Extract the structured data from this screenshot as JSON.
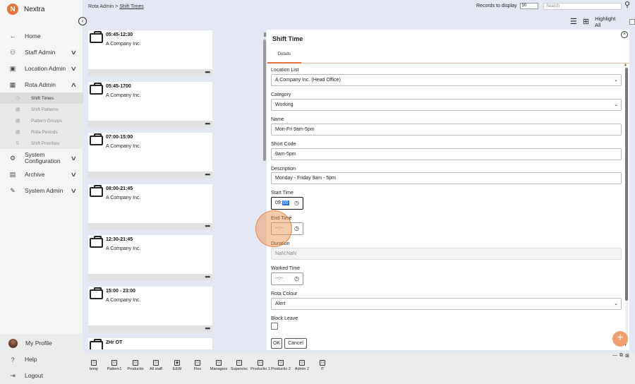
{
  "brand": {
    "name": "Nextra",
    "logo_letter": "N"
  },
  "sidebar": {
    "items": [
      {
        "icon": "arrow-left-icon",
        "glyph": "←",
        "label": "Home",
        "has_chevron": false
      },
      {
        "icon": "staff-icon",
        "glyph": "⚇",
        "label": "Staff Admin",
        "has_chevron": true
      },
      {
        "icon": "location-icon",
        "glyph": "▣",
        "label": "Location Admin",
        "has_chevron": true
      },
      {
        "icon": "calendar-icon",
        "glyph": "▦",
        "label": "Rota Admin",
        "has_chevron": true,
        "expanded": true
      },
      {
        "icon": "settings-icon",
        "glyph": "⚙",
        "label": "System Configuration",
        "has_chevron": true
      },
      {
        "icon": "archive-icon",
        "glyph": "▤",
        "label": "Archive",
        "has_chevron": true
      },
      {
        "icon": "wrench-icon",
        "glyph": "✎",
        "label": "System Admin",
        "has_chevron": true
      }
    ],
    "sub_items": [
      {
        "label": "Shift Times",
        "active": true
      },
      {
        "label": "Shift Patterns",
        "active": false
      },
      {
        "label": "Pattern Groups",
        "active": false
      },
      {
        "label": "Rota Periods",
        "active": false
      },
      {
        "label": "Shift Priorities",
        "active": false
      }
    ],
    "footer": [
      {
        "icon": "avatar",
        "label": "My Profile"
      },
      {
        "icon": "help-icon",
        "glyph": "?",
        "label": "Help"
      },
      {
        "icon": "logout-icon",
        "glyph": "⇥",
        "label": "Logout"
      }
    ]
  },
  "breadcrumb": {
    "parent": "Rota Admin",
    "separator": ">",
    "current": "Shift Times"
  },
  "toolbar": {
    "records_label": "Records to display",
    "records_value": "50",
    "search_placeholder": "Search",
    "highlight_label": "Highlight All"
  },
  "cards": [
    {
      "title": "05:45-12:30",
      "company": "A Company Inc."
    },
    {
      "title": "05:45-1700",
      "company": "A Company Inc."
    },
    {
      "title": "07:00-15:00",
      "company": "A Company Inc."
    },
    {
      "title": "08:00-21:45",
      "company": "A Company Inc."
    },
    {
      "title": "12:30-21:45",
      "company": "A Company Inc."
    },
    {
      "title": "15:00 - 23:00",
      "company": "A Company Inc."
    },
    {
      "title": "2Hr OT",
      "company": ""
    }
  ],
  "panel": {
    "title": "Shift Time",
    "tab": "Details",
    "fields": {
      "location_list": {
        "label": "Location List",
        "value": "A Company Inc. (Head Office)"
      },
      "category": {
        "label": "Category",
        "value": "Working"
      },
      "name": {
        "label": "Name",
        "value": "Mon-Fri 9am-5pm"
      },
      "short_code": {
        "label": "Short Code",
        "value": "9am-5pm"
      },
      "description": {
        "label": "Description",
        "value": "Monday - Friday 9am - 5pm"
      },
      "start_time": {
        "label": "Start Time",
        "hour": "09:",
        "minute": "00"
      },
      "end_time": {
        "label": "End Time",
        "value": "--:--"
      },
      "duration": {
        "label": "Duration",
        "value": "NaN:NaN"
      },
      "worked_time": {
        "label": "Worked Time",
        "value": "--:--"
      },
      "rota_colour": {
        "label": "Rota Colour",
        "value": "Alert"
      },
      "block_leave": {
        "label": "Block Leave",
        "checked": false
      }
    },
    "buttons": {
      "ok": "OK",
      "cancel": "Cancel"
    }
  },
  "taskbar": [
    {
      "label": "temp"
    },
    {
      "label": "Pattern1"
    },
    {
      "label": "Productio"
    },
    {
      "label": "All staff"
    },
    {
      "label": "E&W"
    },
    {
      "label": "Flex"
    },
    {
      "label": "Managers"
    },
    {
      "label": "Supervisc"
    },
    {
      "label": "Productio 1"
    },
    {
      "label": "Productio 2"
    },
    {
      "label": "Admin 2"
    },
    {
      "label": "IT"
    }
  ],
  "colors": {
    "accent": "#e8743b",
    "fab": "#f0a070",
    "selection": "#1a73e8"
  }
}
